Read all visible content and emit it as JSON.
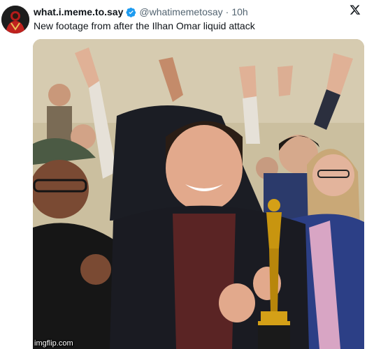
{
  "tweet": {
    "author": {
      "display_name": "what.i.meme.to.say",
      "handle": "@whatimemetosay",
      "verified": true,
      "avatar_icon": "red-robed-figure-avatar"
    },
    "separator": "·",
    "time": "10h",
    "text": "New footage from after the Ilhan Omar liquid attack",
    "close_icon": "x-logo-icon",
    "media": {
      "type": "photo",
      "depicts": "crowd cheering around a smiling man holding a gold statuette"
    }
  },
  "watermark": "imgflip.com",
  "colors": {
    "name": "#0f1419",
    "meta": "#536471",
    "verified": "#1d9bf0",
    "statuette": "#d4a017"
  }
}
